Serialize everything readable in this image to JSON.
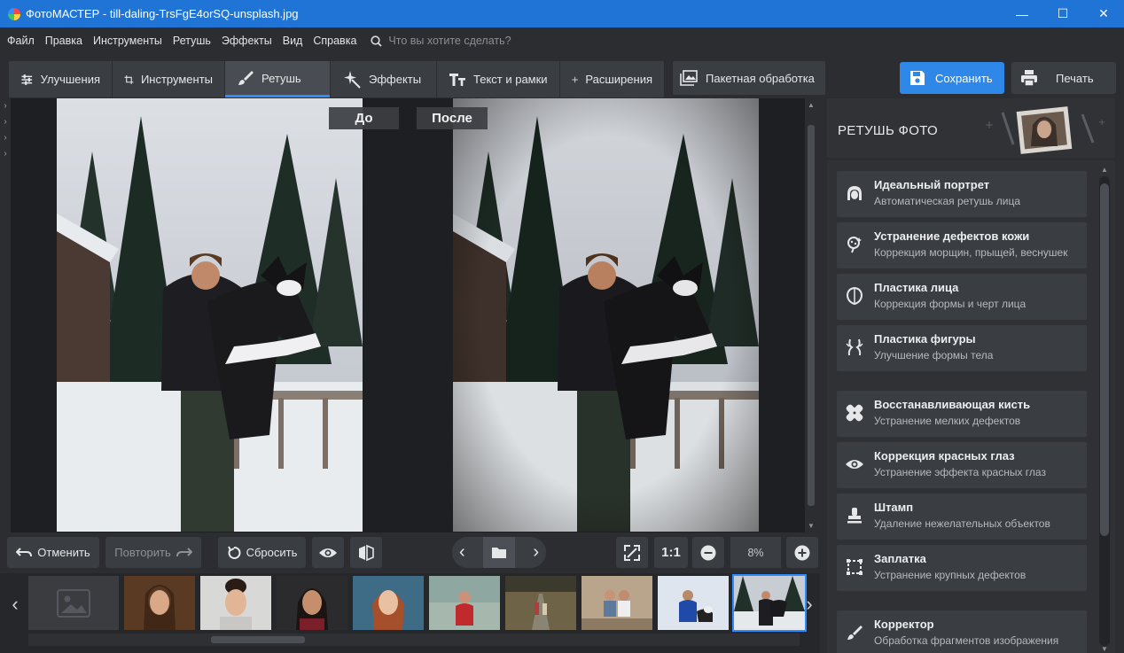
{
  "window": {
    "title": "ФотоМАСТЕР - till-daling-TrsFgE4orSQ-unsplash.jpg",
    "controls": [
      "minimize-icon",
      "maximize-icon",
      "close-icon"
    ]
  },
  "menu": {
    "items": [
      "Файл",
      "Правка",
      "Инструменты",
      "Ретушь",
      "Эффекты",
      "Вид",
      "Справка"
    ],
    "search_placeholder": "Что вы хотите сделать?"
  },
  "toolbar": {
    "tabs": [
      {
        "label": "Улучшения",
        "icon": "sliders-icon"
      },
      {
        "label": "Инструменты",
        "icon": "crop-icon"
      },
      {
        "label": "Ретушь",
        "icon": "brush-icon",
        "active": true
      },
      {
        "label": "Эффекты",
        "icon": "sparkle-icon"
      },
      {
        "label": "Текст и рамки",
        "icon": "text-icon"
      },
      {
        "label": "Расширения",
        "icon": "plus-icon"
      }
    ],
    "batch_label": "Пакетная обработка",
    "save_label": "Сохранить",
    "print_label": "Печать",
    "accent_color": "#2f87e8"
  },
  "canvas": {
    "before_label": "До",
    "after_label": "После"
  },
  "controls": {
    "undo_label": "Отменить",
    "redo_label": "Повторить",
    "reset_label": "Сбросить",
    "fit_label": "1:1",
    "zoom_value": "8%"
  },
  "filmstrip": {
    "thumbnails": [
      {
        "name": "woman-portrait-1"
      },
      {
        "name": "smiling-woman"
      },
      {
        "name": "woman-portrait-dark"
      },
      {
        "name": "red-hair-girl"
      },
      {
        "name": "girl-red-sweater"
      },
      {
        "name": "couple-road"
      },
      {
        "name": "couple-sitting"
      },
      {
        "name": "man-dog-snow"
      },
      {
        "name": "man-husky-current",
        "selected": true
      }
    ]
  },
  "panel": {
    "title": "РЕТУШЬ ФОТО",
    "items": [
      {
        "title": "Идеальный портрет",
        "subtitle": "Автоматическая ретушь лица",
        "icon": "portrait-icon"
      },
      {
        "title": "Устранение дефектов кожи",
        "subtitle": "Коррекция морщин, прыщей, веснушек",
        "icon": "skin-brush-icon"
      },
      {
        "title": "Пластика лица",
        "subtitle": "Коррекция формы и черт лица",
        "icon": "face-shape-icon"
      },
      {
        "title": "Пластика фигуры",
        "subtitle": "Улучшение формы тела",
        "icon": "body-shape-icon"
      },
      {
        "title": "Восстанавливающая кисть",
        "subtitle": "Устранение мелких дефектов",
        "icon": "bandage-icon"
      },
      {
        "title": "Коррекция красных глаз",
        "subtitle": "Устранение эффекта красных глаз",
        "icon": "eye-icon"
      },
      {
        "title": "Штамп",
        "subtitle": "Удаление нежелательных объектов",
        "icon": "stamp-icon"
      },
      {
        "title": "Заплатка",
        "subtitle": "Устранение крупных дефектов",
        "icon": "patch-icon"
      },
      {
        "title": "Корректор",
        "subtitle": "Обработка фрагментов изображения",
        "icon": "corrector-brush-icon"
      }
    ]
  }
}
